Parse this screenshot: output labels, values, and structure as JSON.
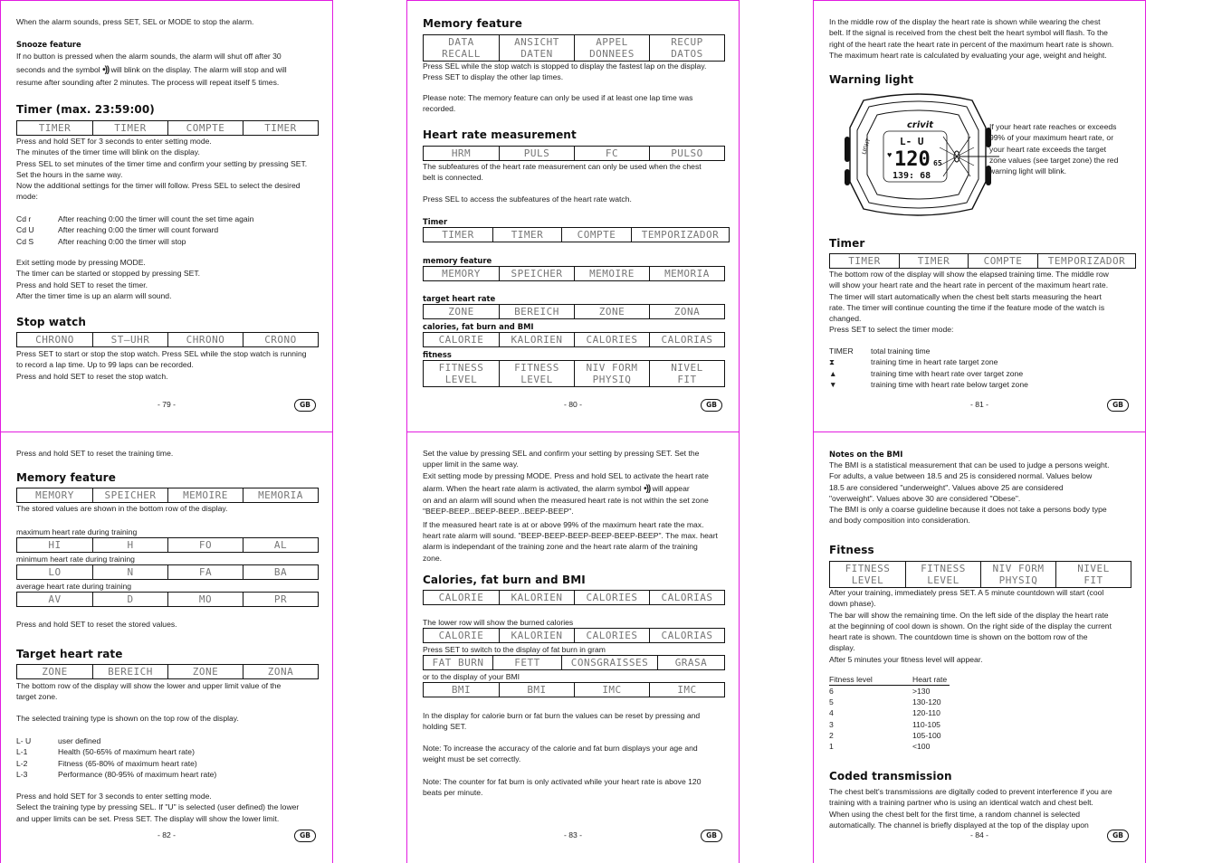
{
  "colors": {
    "page_border": "#e21be0",
    "text": "#222222",
    "lcd_text": "#777777"
  },
  "pages": {
    "p79": {
      "intro": "When the alarm sounds, press SET, SEL or MODE to stop the alarm.",
      "snooze_title": "Snooze feature",
      "snooze_line1": "If no button is pressed when the alarm sounds, the alarm will shut off after 30",
      "snooze_line2a": "seconds and the symbol",
      "snooze_symbol": "•))",
      "snooze_line2b": "will blink on the display. The alarm will stop and will",
      "snooze_line3": "resume after sounding after 2 minutes. The process will repeat itself 5 times.",
      "timer_title": "Timer (max. 23:59:00)",
      "timer_lcd": [
        "TIMER",
        "TIMER",
        "COMPTE",
        "TIMER"
      ],
      "timer_text": [
        "Press and hold SET for 3 seconds to enter setting mode.",
        "The minutes of the timer time will blink on the display.",
        "Press SEL to set minutes of the timer time and confirm your setting by pressing SET.",
        "Set the hours in the same way.",
        "Now the additional settings for the timer will follow. Press SEL to select the desired",
        "mode:"
      ],
      "modes": [
        {
          "key": "Cd r",
          "desc": "After reaching 0:00 the timer will count the set time again"
        },
        {
          "key": "Cd U",
          "desc": "After reaching 0:00 the timer will count forward"
        },
        {
          "key": "Cd S",
          "desc": "After reaching 0:00 the timer will stop"
        }
      ],
      "timer_text2": [
        "Exit setting mode by pressing MODE.",
        "The timer can be started or stopped by pressing SET.",
        "Press and hold SET to reset the timer.",
        "After the timer time is up an alarm will sound."
      ],
      "stopwatch_title": "Stop watch",
      "stopwatch_lcd": [
        "CHRONO",
        "ST–UHR",
        "CHRONO",
        "CRONO"
      ],
      "stopwatch_text": [
        "Press SET to start or stop the stop watch. Press SEL while the stop watch is running",
        "to record a lap time. Up to 99 laps can be recorded.",
        "Press and hold SET to reset the stop watch."
      ],
      "page_number": "- 79 -",
      "lang_badge": "GB"
    },
    "p80": {
      "memory_title": "Memory feature",
      "memory_lcd": [
        "DATA\nRECALL",
        "ANSICHT\nDATEN",
        "APPEL\nDONNEES",
        "RECUP\nDATOS"
      ],
      "memory_text": [
        "Press SEL while the stop watch is stopped to display the fastest lap on the display.",
        "Press SET to display the other lap times."
      ],
      "memory_note": [
        "Please note: The memory feature can only be used if at least one lap time was",
        "recorded."
      ],
      "hrm_title": "Heart rate measurement",
      "hrm_lcd": [
        "HRM",
        "PULS",
        "FC",
        "PULSO"
      ],
      "hrm_text": [
        "The subfeatures of the heart rate measurement can only be used when the chest",
        "belt is connected."
      ],
      "hrm_text2": "Press SEL to access the subfeatures of the heart rate watch.",
      "sub_timer_label": "Timer",
      "sub_timer_lcd": [
        "TIMER",
        "TIMER",
        "COMPTE",
        "TEMPORIZADOR"
      ],
      "sub_memory_label": "memory feature",
      "sub_memory_lcd": [
        "MEMORY",
        "SPEICHER",
        "MEMOIRE",
        "MEMORIA"
      ],
      "sub_target_label": "target heart rate",
      "sub_target_lcd": [
        "ZONE",
        "BEREICH",
        "ZONE",
        "ZONA"
      ],
      "sub_cal_label": "calories, fat burn and BMI",
      "sub_cal_lcd": [
        "CALORIE",
        "KALORIEN",
        "CALORIES",
        "CALORIAS"
      ],
      "sub_fitness_label": "fitness",
      "sub_fitness_lcd": [
        "FITNESS\nLEVEL",
        "FITNESS\nLEVEL",
        "NIV FORM\nPHYSIQ",
        "NIVEL\nFIT"
      ],
      "page_number": "- 80 -",
      "lang_badge": "GB"
    },
    "p81": {
      "intro": [
        "In the middle row of the display the heart rate is shown while wearing the chest",
        "belt. If the signal is received from the chest belt the heart symbol will flash. To the",
        "right of the heart rate the heart rate in percent of the maximum heart rate is shown.",
        "The maximum heart rate is calculated by evaluating your age, weight and height."
      ],
      "warning_title": "Warning light",
      "watch": {
        "brand": "crivit",
        "top_row": "L-  U",
        "middle_value": "120",
        "middle_small": "65",
        "bottom_row": "139: 68",
        "side_label": "LIGHT"
      },
      "warning_text": [
        "If your heart rate reaches or exceeds",
        "99% of your maximum heart rate, or",
        "your heart rate exceeds the target",
        "zone values (see target zone) the red",
        "warning light will blink."
      ],
      "timer_title": "Timer",
      "timer_lcd": [
        "TIMER",
        "TIMER",
        "COMPTE",
        "TEMPORIZADOR"
      ],
      "timer_text": [
        "The bottom row of the display will show the elapsed training time. The middle row",
        "will show your heart rate and the heart rate in percent of the maximum heart rate.",
        "The timer will start automatically when the chest belt starts measuring the heart",
        "rate. The timer will continue counting the time if the feature mode of the watch is",
        "changed.",
        "Press SET to select the timer mode:"
      ],
      "timer_modes": [
        {
          "key": "TIMER",
          "icon": "",
          "desc": "total training time"
        },
        {
          "key": "",
          "icon": "hourglass",
          "glyph": "⧗",
          "desc": "training time in heart rate target zone"
        },
        {
          "key": "",
          "icon": "triangle-up",
          "glyph": "▲",
          "desc": "training time with heart rate over target zone"
        },
        {
          "key": "",
          "icon": "triangle-down",
          "glyph": "▼",
          "desc": "training time with heart rate below target zone"
        }
      ],
      "page_number": "- 81 -",
      "lang_badge": "GB"
    },
    "p82": {
      "intro": "Press and hold SET to reset the training time.",
      "memory_title": "Memory feature",
      "memory_lcd": [
        "MEMORY",
        "SPEICHER",
        "MEMOIRE",
        "MEMORIA"
      ],
      "memory_text": "The stored values are shown in the bottom row of the display.",
      "max_label": "maximum heart rate during training",
      "max_lcd": [
        "HI",
        "H",
        "FO",
        "AL"
      ],
      "min_label": "minimum heart rate during training",
      "min_lcd": [
        "LO",
        "N",
        "FA",
        "BA"
      ],
      "avg_label": "average heart rate during training",
      "avg_lcd": [
        "AV",
        "D",
        "MO",
        "PR"
      ],
      "reset_text": "Press and hold SET to reset the stored values.",
      "target_title": "Target heart rate",
      "target_lcd": [
        "ZONE",
        "BEREICH",
        "ZONE",
        "ZONA"
      ],
      "target_text": [
        "The bottom row of the display will show the lower and upper limit value of the",
        "target zone."
      ],
      "target_text2": "The selected training type is shown on the top row of the display.",
      "levels": [
        {
          "key": "L- U",
          "desc": "user defined"
        },
        {
          "key": "L-1",
          "desc": "Health (50-65% of maximum heart rate)"
        },
        {
          "key": "L-2",
          "desc": "Fitness (65-80% of maximum heart rate)"
        },
        {
          "key": "L-3",
          "desc": "Performance (80-95% of maximum heart rate)"
        }
      ],
      "setting_text": [
        "Press and hold SET for 3 seconds to enter setting mode.",
        "Select the training type by pressing SEL. If \"U\" is selected (user defined) the lower",
        "and upper limits can be set. Press SET. The display will show the lower limit."
      ],
      "page_number": "- 82 -",
      "lang_badge": "GB"
    },
    "p83": {
      "intro": [
        "Set the value by pressing SEL and confirm your setting by pressing SET. Set the",
        "upper limit in the same way.",
        "Exit setting mode by pressing MODE. Press and hold SEL to activate the heart rate"
      ],
      "alarm_line_a": "alarm. When the heart rate alarm is activated, the alarm symbol",
      "alarm_symbol": "•))",
      "alarm_line_b": "will appear",
      "intro2": [
        "on and an alarm will sound when the measured heart rate is not within the set zone",
        "\"BEEP-BEEP...BEEP-BEEP...BEEP-BEEP\".",
        "If the measured heart rate is at or above 99% of the maximum heart rate the max.",
        "heart rate alarm will sound. \"BEEP-BEEP-BEEP-BEEP-BEEP-BEEP\". The max. heart",
        "alarm is independant of the training zone and the heart rate alarm of the training",
        "zone."
      ],
      "cal_title": "Calories,  fat burn and BMI",
      "cal_lcd": [
        "CALORIE",
        "KALORIEN",
        "CALORIES",
        "CALORIAS"
      ],
      "lower_row_text": "The lower row will show the burned calories",
      "lower_lcd": [
        "CALORIE",
        "KALORIEN",
        "CALORIES",
        "CALORIAS"
      ],
      "fat_text": "Press SET to switch to the display of fat burn in gram",
      "fat_lcd": [
        "FAT BURN",
        "FETT",
        "CONSGRAISSES",
        "GRASA"
      ],
      "bmi_text": "or to the display of your BMI",
      "bmi_lcd": [
        "BMI",
        "BMI",
        "IMC",
        "IMC"
      ],
      "reset_text": [
        "In the display for calorie burn or fat burn the values can be reset by pressing and",
        "holding SET."
      ],
      "note1": [
        "Note: To increase the accuracy of the calorie and fat burn displays your age and",
        "weight must be set correctly."
      ],
      "note2": [
        "Note: The counter for fat burn is only activated while your heart rate is above 120",
        "beats per minute."
      ],
      "page_number": "- 83 -",
      "lang_badge": "GB"
    },
    "p84": {
      "bmi_title": "Notes on the BMI",
      "bmi_text": [
        "The BMI is a statistical measurement that can be used to judge a persons weight.",
        "For adults, a value between 18.5 and 25 is considered normal. Values below",
        "18.5 are considered \"underweight\". Values above 25 are considered",
        "\"overweight\". Values above 30 are considered \"Obese\".",
        "The BMI is only a coarse guideline because it does not take a persons body type",
        "and body composition into consideration."
      ],
      "fitness_title": "Fitness",
      "fitness_lcd": [
        "FITNESS\nLEVEL",
        "FITNESS\nLEVEL",
        "NIV FORM\nPHYSIQ",
        "NIVEL\nFIT"
      ],
      "fitness_text": [
        "After your training, immediately press SET. A 5 minute countdown will start (cool",
        "down phase).",
        "The bar will show the remaining time. On the left side of the display the heart rate",
        "at the beginning of cool down is shown. On the right side of the display the current",
        "heart rate is shown. The countdown time is shown on the bottom row of the",
        "display.",
        "After 5 minutes your fitness level will appear."
      ],
      "fitness_table": {
        "headers": [
          "Fitness level",
          "Heart rate"
        ],
        "rows": [
          [
            "6",
            ">130"
          ],
          [
            "5",
            "130-120"
          ],
          [
            "4",
            "120-110"
          ],
          [
            "3",
            "110-105"
          ],
          [
            "2",
            "105-100"
          ],
          [
            "1",
            "<100"
          ]
        ]
      },
      "coded_title": "Coded transmission",
      "coded_text": [
        "The chest belt's transmissions are digitally coded to prevent interference if you are",
        "training with a training partner who is using an identical watch and chest belt.",
        "When using the chest belt for the first time, a random channel is selected",
        "automatically. The channel is briefly displayed at the top of the display upon"
      ],
      "page_number": "- 84 -",
      "lang_badge": "GB"
    }
  }
}
